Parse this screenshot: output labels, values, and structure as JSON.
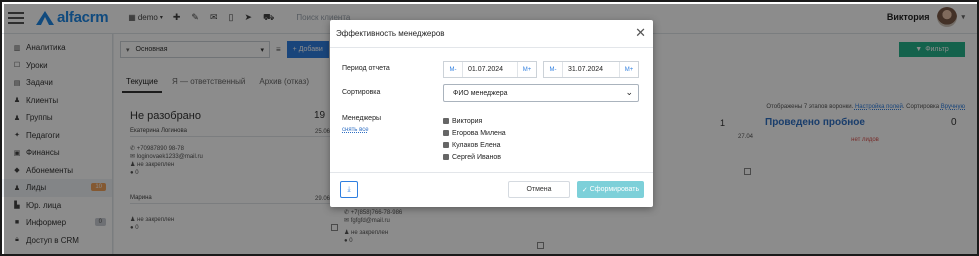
{
  "topbar": {
    "logo_text": "alfacrm",
    "account": "demo",
    "search_placeholder": "Поиск клиента",
    "user_name": "Виктория",
    "icons": [
      "plus-icon",
      "wrench-icon",
      "mail-icon",
      "phone-icon",
      "send-icon",
      "cart-icon"
    ]
  },
  "sidebar": {
    "items": [
      {
        "label": "Аналитика",
        "icon": "chart-icon"
      },
      {
        "label": "Уроки",
        "icon": "calendar-icon"
      },
      {
        "label": "Задачи",
        "icon": "tasks-icon"
      },
      {
        "label": "Клиенты",
        "icon": "user-icon"
      },
      {
        "label": "Группы",
        "icon": "group-icon"
      },
      {
        "label": "Педагоги",
        "icon": "teacher-icon"
      },
      {
        "label": "Финансы",
        "icon": "money-icon"
      },
      {
        "label": "Абонементы",
        "icon": "tag-icon"
      },
      {
        "label": "Лиды",
        "icon": "leads-icon",
        "badge": "10"
      },
      {
        "label": "Юр. лица",
        "icon": "building-icon"
      },
      {
        "label": "Информер",
        "icon": "informer-icon",
        "badge": "0"
      },
      {
        "label": "Доступ в CRM",
        "icon": "lock-icon"
      }
    ]
  },
  "main": {
    "funnel_select": "Основная",
    "add_button": "+ Добави",
    "filter_button": "Фильтр",
    "tabs": [
      "Текущие",
      "Я — ответственный",
      "Архив (отказ)"
    ],
    "funnel_info_prefix": "Отображены 7 этапов воронки.",
    "funnel_info_link1": "Настройка полей",
    "funnel_info_mid": "Сортировка",
    "funnel_info_link2": "Вручную",
    "col1": {
      "title": "Не разобрано",
      "count": "19",
      "card1_name": "Екатерина Логинова",
      "card1_date": "25.06",
      "card1_phone": "+70987890 98-78",
      "card1_email": "loginovaek1233@mail.ru",
      "card1_status": "не закреплен",
      "card1_zero": "0",
      "card2_name": "Марина",
      "card2_date": "29.06",
      "card2_status": "не закреплен",
      "card2_zero": "0"
    },
    "col2": {
      "card_phone": "+7(858)766-78-986",
      "card_email": "fgfgfd@mail.ru",
      "card_status": "не закреплен",
      "card_zero": "0"
    },
    "col3_date": "27.04",
    "col3_count": "1",
    "col4": {
      "title": "Проведено пробное",
      "count": "0",
      "empty": "нет лидов"
    }
  },
  "modal": {
    "title": "Эффективность менеджеров",
    "period_label": "Период отчета",
    "date_from": "01.07.2024",
    "date_to": "31.07.2024",
    "prev": "M-",
    "next": "M+",
    "sort_label": "Сортировка",
    "sort_value": "ФИО менеджера",
    "managers_label": "Менеджеры",
    "unselect_all": "снять все",
    "managers": [
      "Виктория",
      "Егорова Милена",
      "Кулаков Елена",
      "Сергей Иванов"
    ],
    "cancel": "Отмена",
    "submit": "Сформировать"
  }
}
